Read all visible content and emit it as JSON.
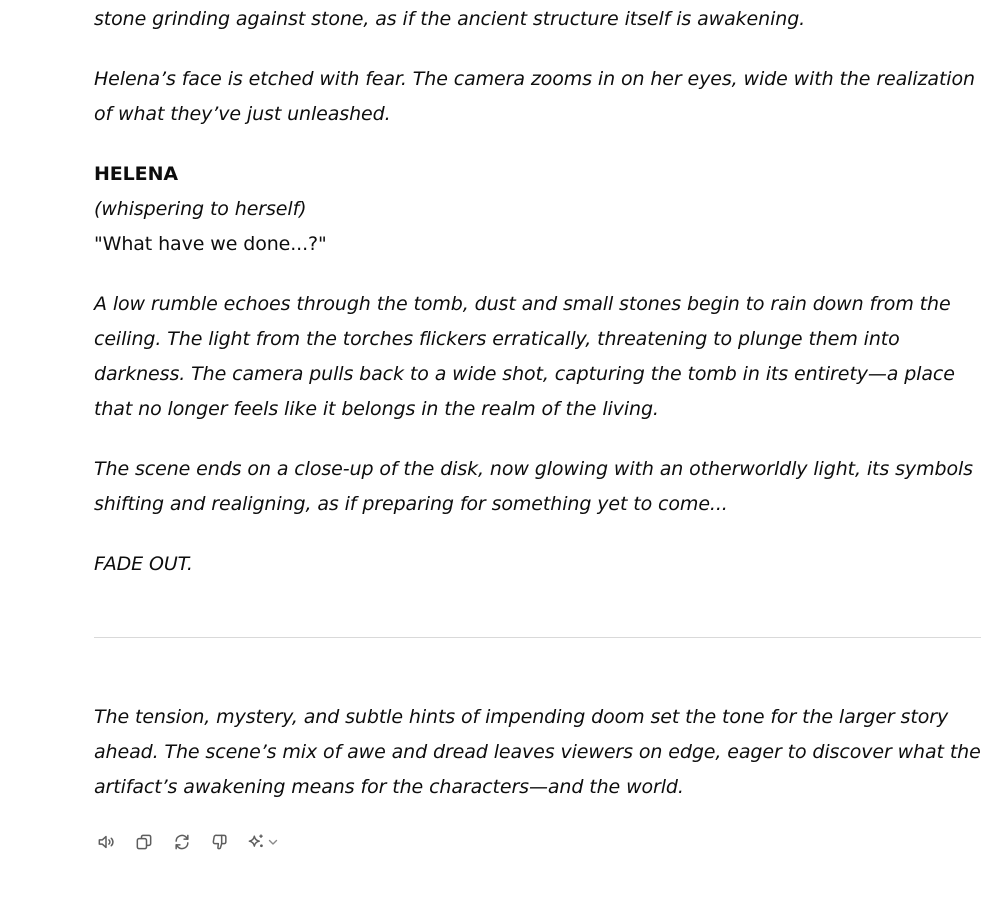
{
  "response": {
    "paragraphs": [
      {
        "id": "p1",
        "text": "stone grinding against stone, as if the ancient structure itself is awakening."
      },
      {
        "id": "p2",
        "text": "Helena’s face is etched with fear. The camera zooms in on her eyes, wide with the realization of what they’ve just unleashed."
      },
      {
        "id": "character",
        "text": "HELENA"
      },
      {
        "id": "parenthetical",
        "text": "(whispering to herself)"
      },
      {
        "id": "dialogue",
        "text": "\"What have we done...?\""
      },
      {
        "id": "p3",
        "text": "A low rumble echoes through the tomb, dust and small stones begin to rain down from the ceiling. The light from the torches flickers erratically, threatening to plunge them into darkness. The camera pulls back to a wide shot, capturing the tomb in its entirety—a place that no longer feels like it belongs in the realm of the living."
      },
      {
        "id": "p4",
        "text": "The scene ends on a close-up of the disk, now glowing with an otherworldly light, its symbols shifting and realigning, as if preparing for something yet to come..."
      },
      {
        "id": "p5",
        "text": "FADE OUT."
      }
    ],
    "closing": "The tension, mystery, and subtle hints of impending doom set the tone for the larger story ahead. The scene’s mix of awe and dread leaves viewers on edge, eager to discover what the artifact’s awakening means for the characters—and the world."
  },
  "toolbar": {
    "buttons": [
      {
        "icon": "speaker-icon"
      },
      {
        "icon": "copy-icon"
      },
      {
        "icon": "regenerate-icon"
      },
      {
        "icon": "thumbs-down-icon"
      },
      {
        "icon": "sparkle-icon"
      }
    ]
  }
}
